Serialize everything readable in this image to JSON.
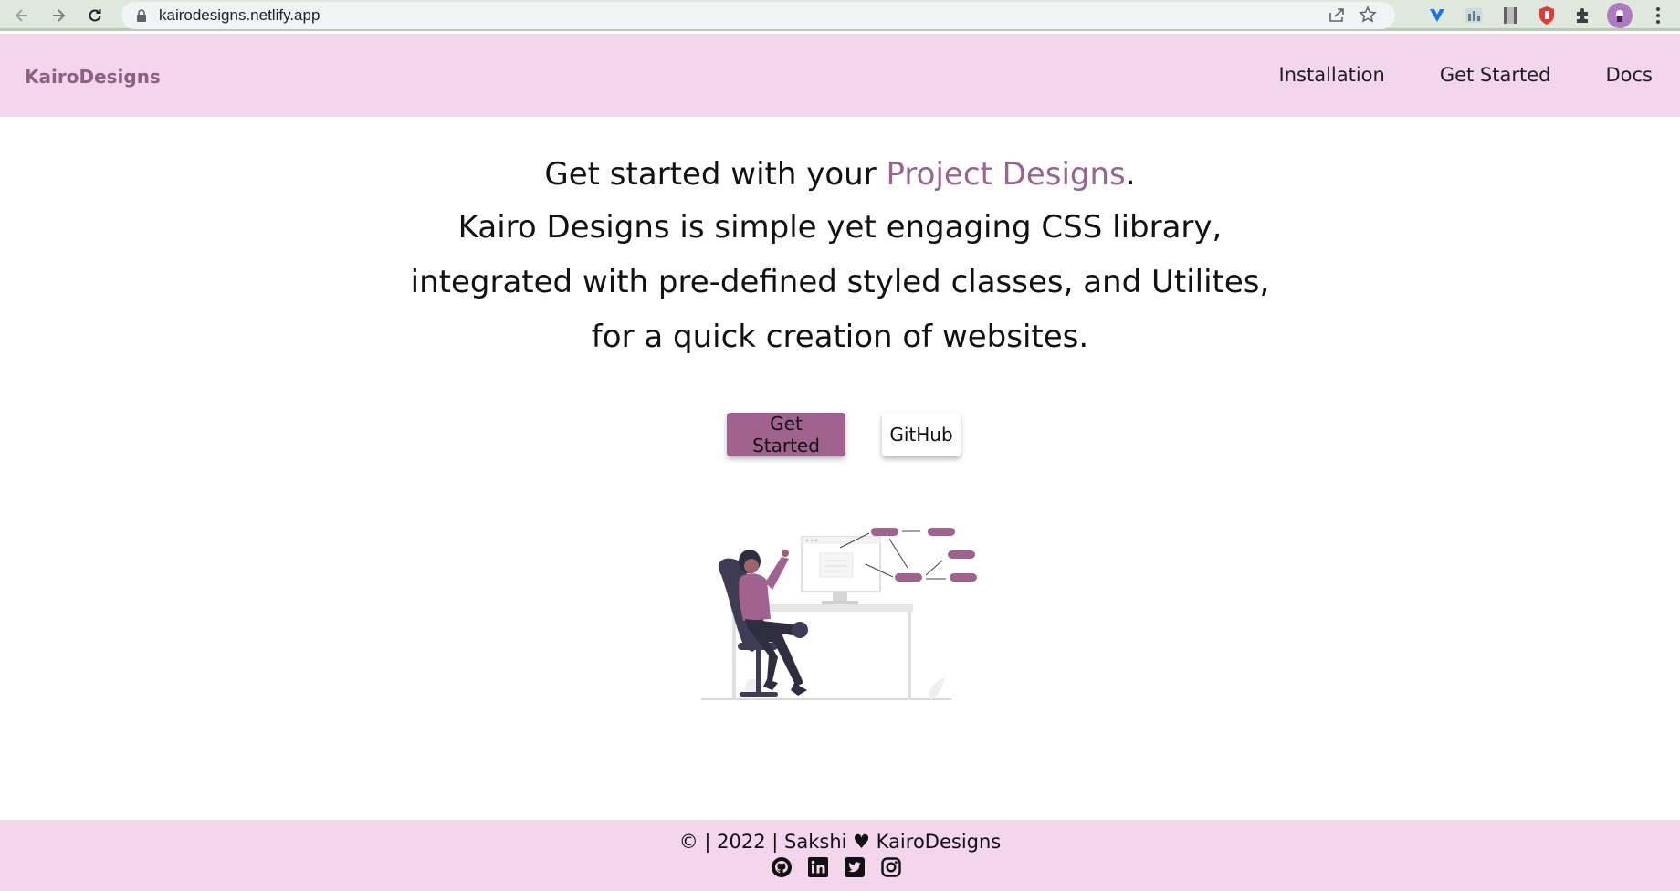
{
  "browser": {
    "url": "kairodesigns.netlify.app",
    "icons": [
      "back-icon",
      "forward-icon",
      "reload-icon",
      "lock-icon",
      "share-icon",
      "bookmark-star-icon",
      "extension-icons",
      "menu-icon"
    ]
  },
  "site": {
    "brand": "KairoDesigns",
    "nav": [
      {
        "label": "Installation"
      },
      {
        "label": "Get Started"
      },
      {
        "label": "Docs"
      }
    ],
    "hero": {
      "line1_prefix": "Get started with your ",
      "line1_accent": "Project Designs",
      "line1_suffix": ".",
      "description": "Kairo Designs is simple yet engaging CSS library, integrated with pre-defined styled classes, and Utilites, for a quick creation of websites."
    },
    "buttons": {
      "primary": "Get Started",
      "secondary": "GitHub"
    },
    "footer": {
      "text": "© | 2022 | Sakshi ♥ KairoDesigns",
      "socials": [
        "github-icon",
        "linkedin-icon",
        "twitter-icon",
        "instagram-icon"
      ]
    }
  },
  "colors": {
    "nav_bg": "#f3d5ec",
    "brand": "#8f5f84",
    "accent": "#9b6390",
    "primary_button": "#a0628f",
    "footer_bg": "#f3d5ec"
  }
}
